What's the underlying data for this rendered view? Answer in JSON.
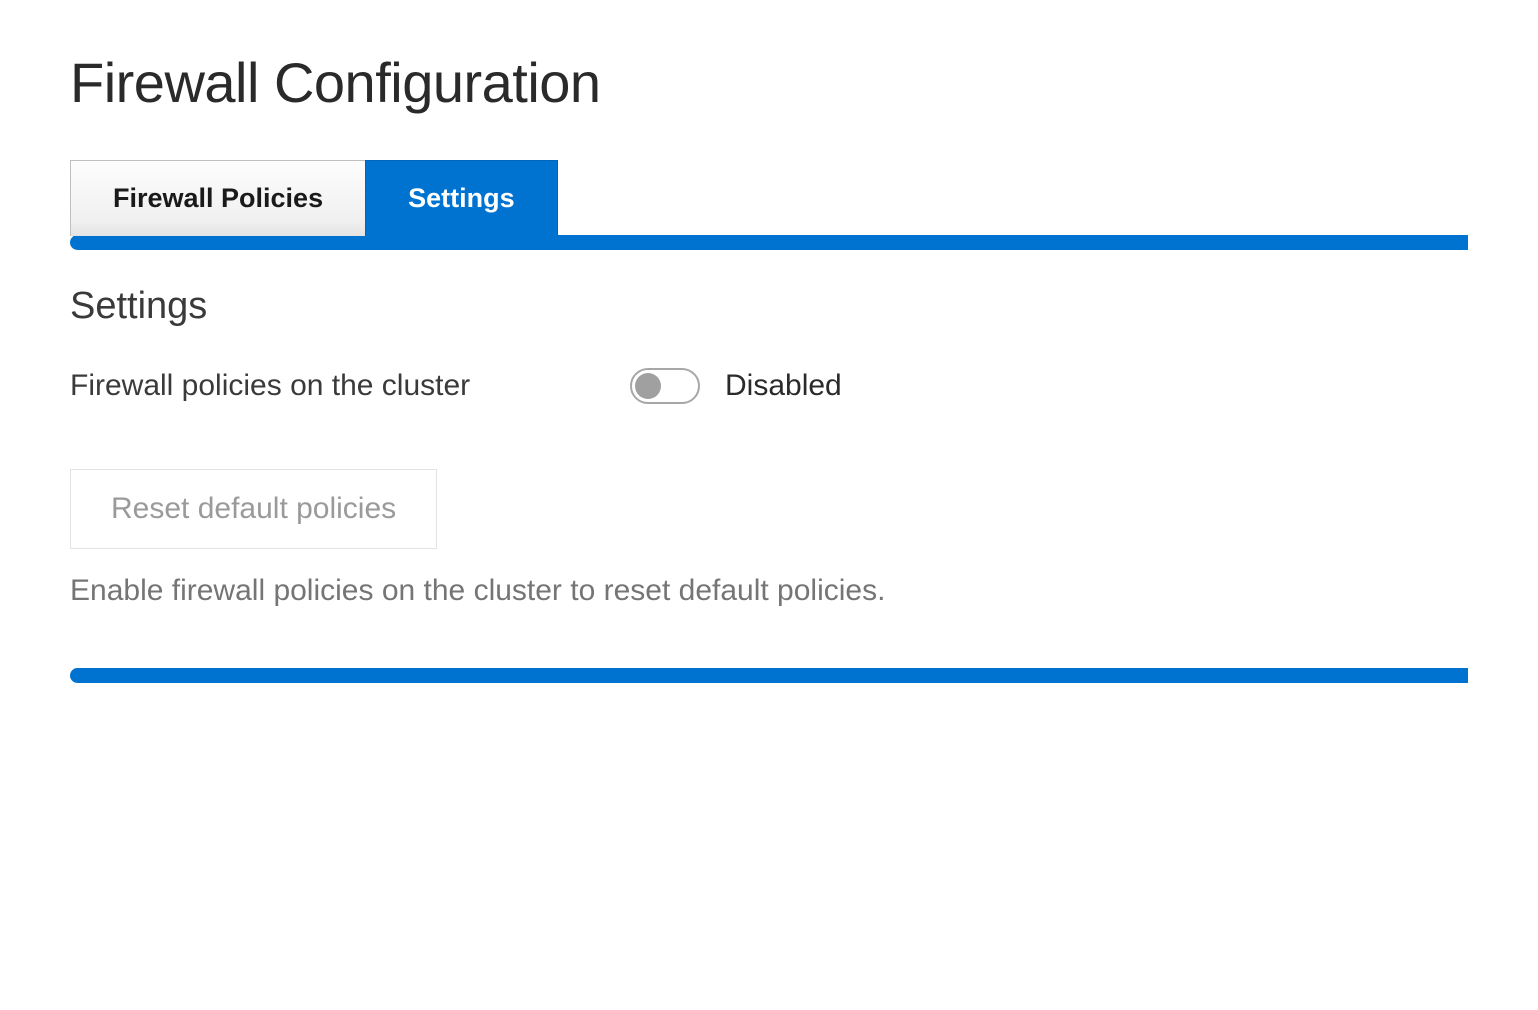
{
  "header": {
    "title": "Firewall Configuration"
  },
  "tabs": {
    "items": [
      {
        "label": "Firewall Policies",
        "active": false
      },
      {
        "label": "Settings",
        "active": true
      }
    ]
  },
  "settings": {
    "heading": "Settings",
    "policy_toggle": {
      "label": "Firewall policies on the cluster",
      "state": "Disabled"
    },
    "reset_button": {
      "label": "Reset default policies"
    },
    "helper": "Enable firewall policies on the cluster to reset default policies."
  }
}
